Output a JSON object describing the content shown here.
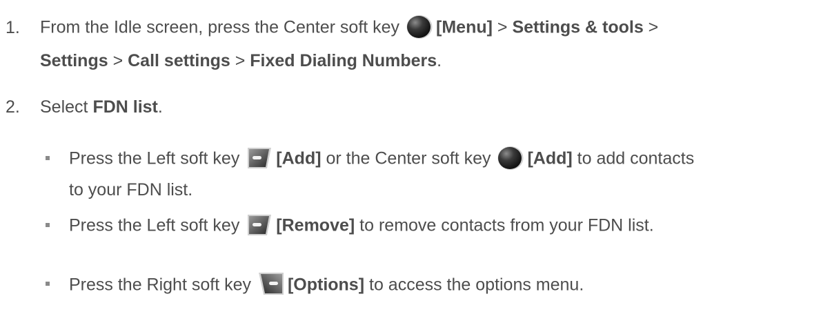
{
  "steps": [
    {
      "number": "1.",
      "line1": {
        "text_a": "From the Idle screen, press the Center soft key ",
        "icon": "center-soft-key-icon",
        "label_menu": "[Menu]",
        "sep1": " > ",
        "label_settings_tools": "Settings & tools",
        "sep2": " >"
      },
      "line2": {
        "label_settings": "Settings",
        "sep1": " > ",
        "label_call_settings": "Call settings",
        "sep2": " > ",
        "label_fdn": "Fixed Dialing Numbers",
        "end": "."
      }
    },
    {
      "number": "2.",
      "text_a": "Select ",
      "label_fdn_list": "FDN list",
      "end": "."
    }
  ],
  "bullets": [
    {
      "line1": {
        "text_a": "Press the Left soft key ",
        "icon1": "left-soft-key-icon",
        "label_add1": "[Add]",
        "text_b": " or the Center soft key ",
        "icon2": "center-soft-key-icon",
        "label_add2": "[Add]",
        "text_c": " to add contacts"
      },
      "line2": "to your FDN list."
    },
    {
      "text_a": "Press the Left soft key ",
      "icon": "left-soft-key-icon",
      "label_remove": "[Remove]",
      "text_b": " to remove contacts from your FDN list."
    },
    {
      "text_a": "Press the Right soft key ",
      "icon": "right-soft-key-icon",
      "label_options": "[Options]",
      "text_b": " to access the options menu."
    }
  ],
  "colors": {
    "text": "#4d4d4d",
    "key_dark": "#2b2b2b",
    "key_light": "#c8c8c8"
  }
}
